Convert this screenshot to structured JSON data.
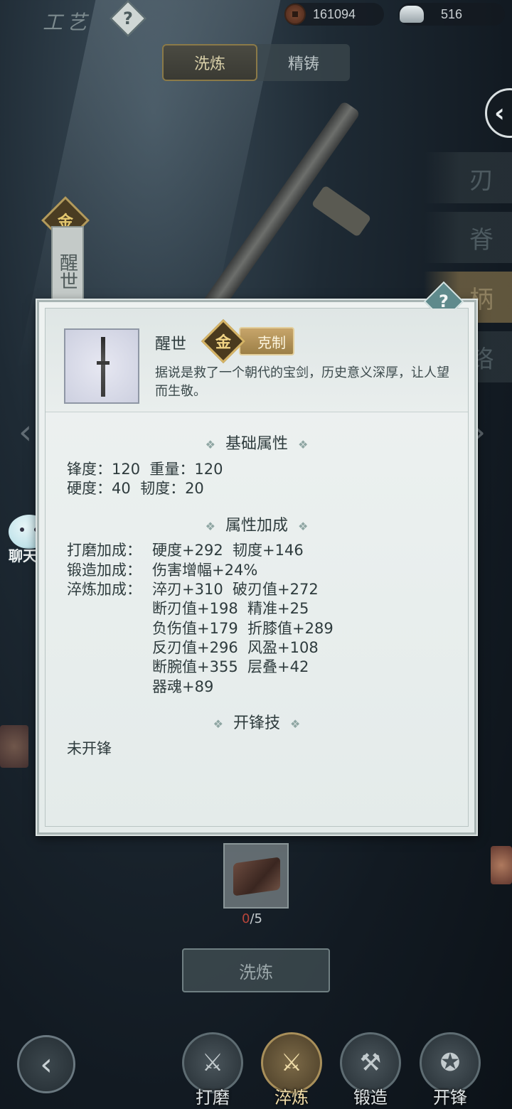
{
  "header": {
    "title": "工艺",
    "help": "?",
    "currency": [
      {
        "icon": "copper-coin-icon",
        "value": "161094"
      },
      {
        "icon": "silver-ingot-icon",
        "value": "516"
      }
    ]
  },
  "tabs": [
    {
      "label": "洗炼",
      "active": true
    },
    {
      "label": "精铸",
      "active": false
    }
  ],
  "parts": [
    {
      "label": "刃",
      "active": false
    },
    {
      "label": "脊",
      "active": false
    },
    {
      "label": "柄",
      "active": true
    },
    {
      "label": "铬",
      "active": false
    }
  ],
  "weapon_card": {
    "badge": "金",
    "name": "醒世"
  },
  "chat": {
    "label": "聊天"
  },
  "item": {
    "name": "醒世",
    "element_badge": "金",
    "counter_tag": "克制",
    "description": "据说是救了一个朝代的宝剑，历史意义深厚，让人望而生敬。"
  },
  "sections": {
    "base": {
      "title": "基础属性",
      "lines": [
        "锋度：120  重量：120",
        "硬度：40  韧度：20"
      ]
    },
    "bonus": {
      "title": "属性加成",
      "rows": [
        {
          "label": "打磨加成：",
          "values": [
            "硬度+292  韧度+146"
          ]
        },
        {
          "label": "锻造加成：",
          "values": [
            "伤害增幅+24%"
          ]
        },
        {
          "label": "淬炼加成：",
          "values": [
            "淬刃+310  破刃值+272",
            "断刃值+198  精准+25",
            "负伤值+179  折膝值+289",
            "反刃值+296  风盈+108",
            "断腕值+355  层叠+42",
            "器魂+89"
          ]
        }
      ]
    },
    "skill": {
      "title": "开锋技",
      "text": "未开锋"
    }
  },
  "material": {
    "have": "0",
    "need": "/5"
  },
  "wash_button": "洗炼",
  "bottom_nav": [
    {
      "label": "打磨",
      "icon": "grind-icon",
      "active": false
    },
    {
      "label": "淬炼",
      "icon": "quench-icon",
      "active": true
    },
    {
      "label": "锻造",
      "icon": "anvil-icon",
      "active": false
    },
    {
      "label": "开锋",
      "icon": "blade-ring-icon",
      "active": false
    }
  ]
}
